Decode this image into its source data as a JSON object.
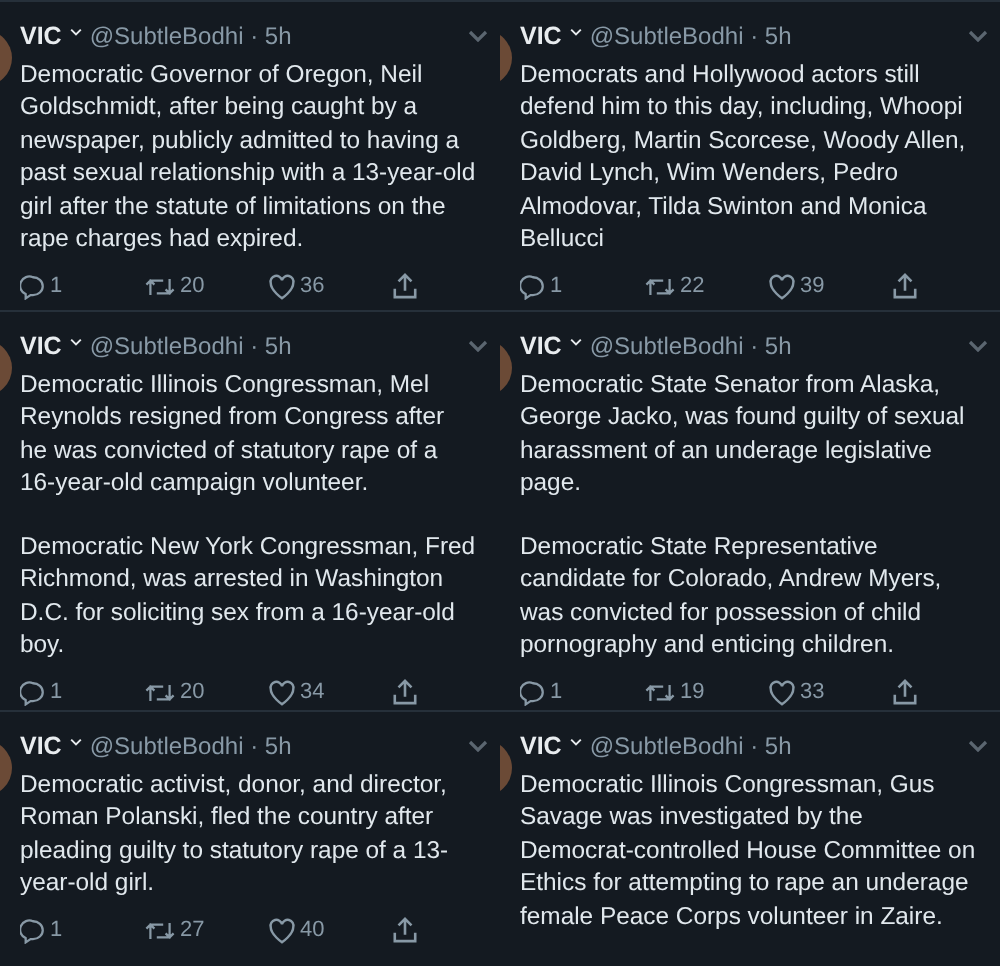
{
  "tweets": [
    {
      "name": "VIC",
      "meta": "@SubtleBodhi · 5h",
      "paragraphs": [
        "Democratic Governor of Oregon, Neil Goldschmidt, after being caught by a newspaper, publicly admitted to having a past sexual relationship with a 13-year-old girl after the statute of limitations on the rape charges had expired."
      ],
      "actions": {
        "replies": "1",
        "retweets": "20",
        "likes": "36"
      }
    },
    {
      "name": "VIC",
      "meta": "@SubtleBodhi · 5h",
      "paragraphs": [
        "Democrats and Hollywood actors still defend him to this day, including, Whoopi Goldberg, Martin Scorcese, Woody Allen, David Lynch, Wim Wenders, Pedro Almodovar, Tilda Swinton and Monica Bellucci"
      ],
      "actions": {
        "replies": "1",
        "retweets": "22",
        "likes": "39"
      }
    },
    {
      "name": "VIC",
      "meta": "@SubtleBodhi · 5h",
      "paragraphs": [
        "Democratic Illinois Congressman, Mel Reynolds resigned from Congress after he was convicted of statutory rape of a 16-year-old campaign volunteer.",
        "Democratic New York Congressman, Fred Richmond, was arrested in Washington D.C. for soliciting sex from a 16-year-old boy."
      ],
      "actions": {
        "replies": "1",
        "retweets": "20",
        "likes": "34"
      }
    },
    {
      "name": "VIC",
      "meta": "@SubtleBodhi · 5h",
      "paragraphs": [
        "Democratic State Senator from Alaska, George Jacko, was found guilty of sexual harassment of an underage legislative page.",
        "Democratic State Representative candidate for Colorado, Andrew Myers, was convicted for possession of child pornography and enticing children."
      ],
      "actions": {
        "replies": "1",
        "retweets": "19",
        "likes": "33"
      }
    },
    {
      "name": "VIC",
      "meta": "@SubtleBodhi · 5h",
      "paragraphs": [
        "Democratic activist, donor, and director, Roman Polanski, fled the country after pleading guilty to statutory rape of a 13-year-old girl."
      ],
      "actions": {
        "replies": "1",
        "retweets": "27",
        "likes": "40"
      }
    },
    {
      "name": "VIC",
      "meta": "@SubtleBodhi · 5h",
      "paragraphs": [
        "Democratic Illinois Congressman, Gus Savage was investigated by the Democrat-controlled House Committee on Ethics for attempting to rape an underage female Peace Corps volunteer in Zaire."
      ]
    }
  ]
}
